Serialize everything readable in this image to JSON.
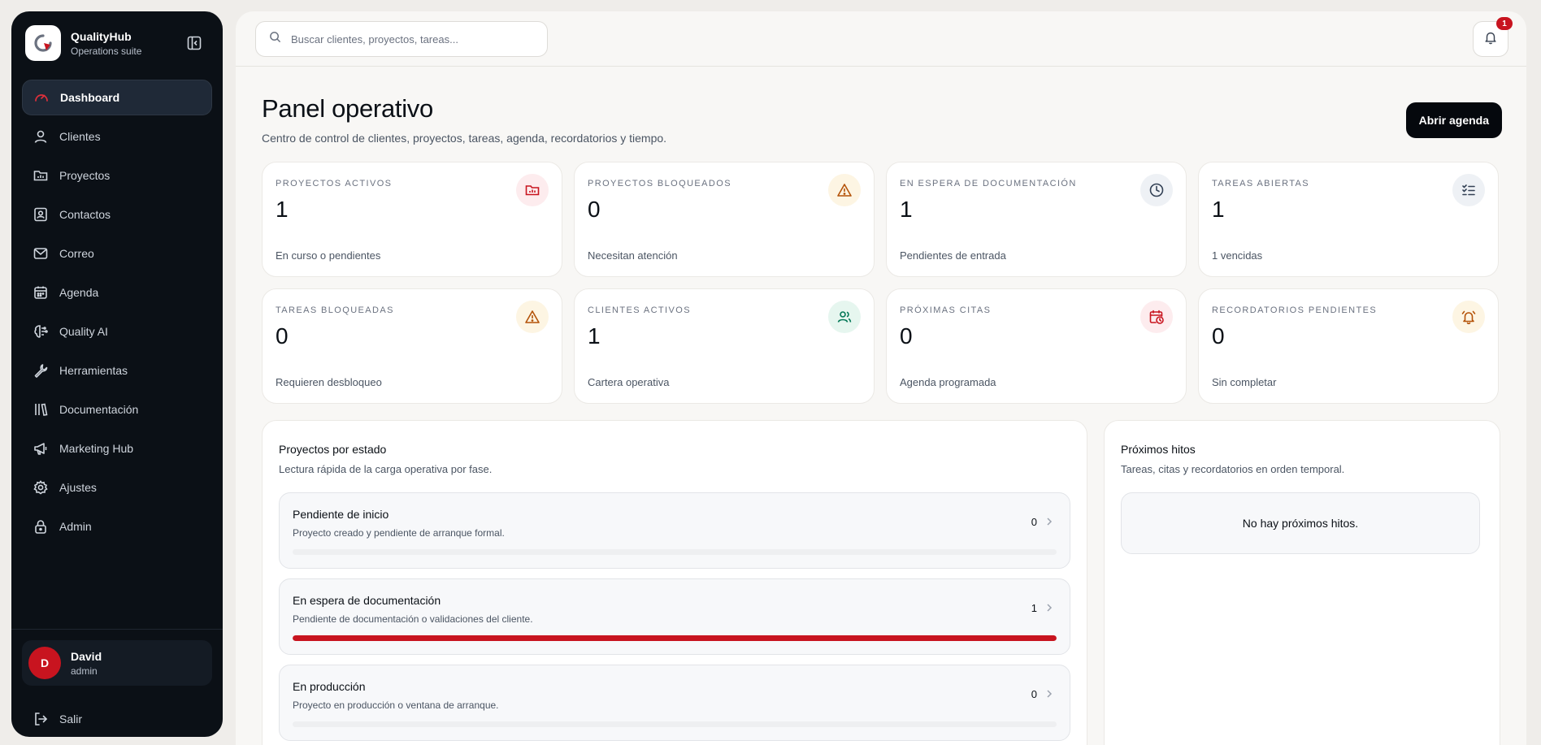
{
  "brand": {
    "name": "QualityHub",
    "subtitle": "Operations suite"
  },
  "sidebar": {
    "items": [
      {
        "label": "Dashboard",
        "icon": "gauge-icon",
        "active": true
      },
      {
        "label": "Clientes",
        "icon": "user-icon"
      },
      {
        "label": "Proyectos",
        "icon": "folder-chart-icon"
      },
      {
        "label": "Contactos",
        "icon": "contact-card-icon"
      },
      {
        "label": "Correo",
        "icon": "mail-icon"
      },
      {
        "label": "Agenda",
        "icon": "calendar-icon"
      },
      {
        "label": "Quality AI",
        "icon": "brain-icon"
      },
      {
        "label": "Herramientas",
        "icon": "wrench-icon"
      },
      {
        "label": "Documentación",
        "icon": "library-icon"
      },
      {
        "label": "Marketing Hub",
        "icon": "megaphone-icon"
      },
      {
        "label": "Ajustes",
        "icon": "gear-icon"
      },
      {
        "label": "Admin",
        "icon": "lock-icon"
      }
    ]
  },
  "user": {
    "initial": "D",
    "name": "David",
    "role": "admin"
  },
  "logout_label": "Salir",
  "search": {
    "placeholder": "Buscar clientes, proyectos, tareas..."
  },
  "notifications": {
    "count": "1"
  },
  "header": {
    "title": "Panel operativo",
    "subtitle": "Centro de control de clientes, proyectos, tareas, agenda, recordatorios y tiempo.",
    "agenda_button": "Abrir agenda"
  },
  "stats": [
    {
      "label": "Proyectos activos",
      "value": "1",
      "desc": "En curso o pendientes",
      "icon": "folder-chart-icon",
      "color": "#c8141f",
      "bg": "#fdecee"
    },
    {
      "label": "Proyectos bloqueados",
      "value": "0",
      "desc": "Necesitan atención",
      "icon": "warning-icon",
      "color": "#b45309",
      "bg": "#fdf5e3"
    },
    {
      "label": "En espera de documentación",
      "value": "1",
      "desc": "Pendientes de entrada",
      "icon": "clock-icon",
      "color": "#334155",
      "bg": "#eef1f5"
    },
    {
      "label": "Tareas abiertas",
      "value": "1",
      "desc": "1 vencidas",
      "icon": "checklist-icon",
      "color": "#334155",
      "bg": "#eef1f5"
    },
    {
      "label": "Tareas bloqueadas",
      "value": "0",
      "desc": "Requieren desbloqueo",
      "icon": "warning-icon",
      "color": "#b45309",
      "bg": "#fdf5e3"
    },
    {
      "label": "Clientes activos",
      "value": "1",
      "desc": "Cartera operativa",
      "icon": "users-icon",
      "color": "#047857",
      "bg": "#e6f6ef"
    },
    {
      "label": "Próximas citas",
      "value": "0",
      "desc": "Agenda programada",
      "icon": "calendar-clock-icon",
      "color": "#c8141f",
      "bg": "#fdecee"
    },
    {
      "label": "Recordatorios pendientes",
      "value": "0",
      "desc": "Sin completar",
      "icon": "alarm-bell-icon",
      "color": "#b45309",
      "bg": "#fdf5e3"
    }
  ],
  "projects_panel": {
    "title": "Proyectos por estado",
    "subtitle": "Lectura rápida de la carga operativa por fase.",
    "phases": [
      {
        "title": "Pendiente de inicio",
        "desc": "Proyecto creado y pendiente de arranque formal.",
        "count": "0",
        "fill": 0
      },
      {
        "title": "En espera de documentación",
        "desc": "Pendiente de documentación o validaciones del cliente.",
        "count": "1",
        "fill": 1
      },
      {
        "title": "En producción",
        "desc": "Proyecto en producción o ventana de arranque.",
        "count": "0",
        "fill": 0
      }
    ]
  },
  "milestones_panel": {
    "title": "Próximos hitos",
    "subtitle": "Tareas, citas y recordatorios en orden temporal.",
    "empty": "No hay próximos hitos."
  },
  "colors": {
    "accent": "#c8141f",
    "sidebar": "#0b1016",
    "button": "#05080d"
  }
}
